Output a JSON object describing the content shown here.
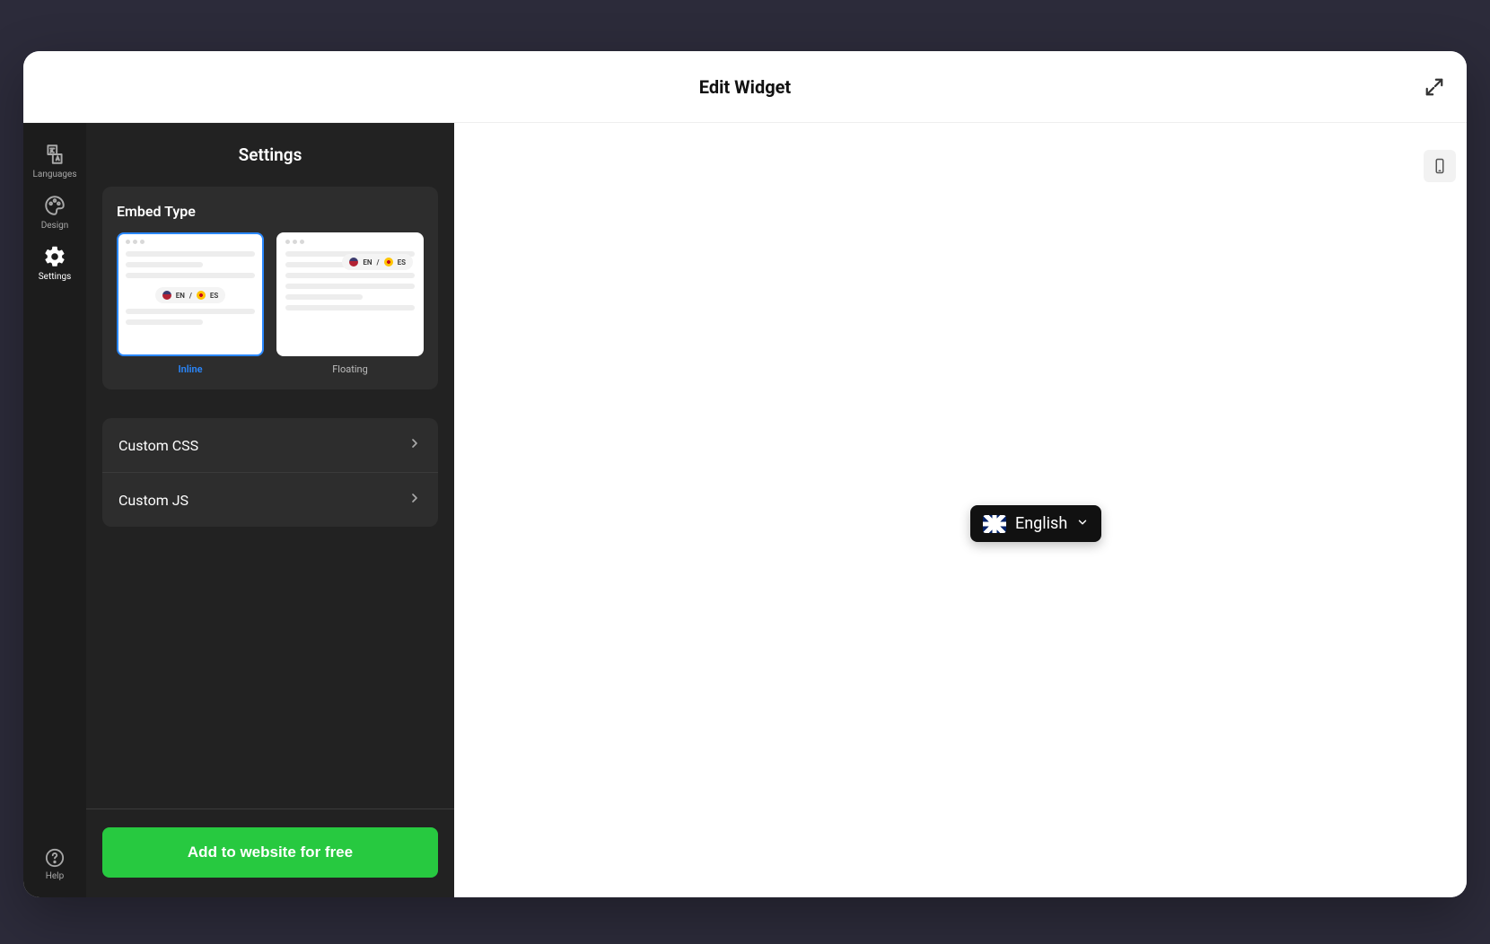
{
  "modal": {
    "title": "Edit Widget"
  },
  "minisidebar": {
    "items": [
      {
        "label": "Languages"
      },
      {
        "label": "Design"
      },
      {
        "label": "Settings"
      }
    ],
    "help": "Help"
  },
  "settings": {
    "heading": "Settings",
    "embed": {
      "title": "Embed Type",
      "options": [
        {
          "label": "Inline",
          "pill_en": "EN",
          "pill_sep": "/",
          "pill_es": "ES"
        },
        {
          "label": "Floating",
          "pill_en": "EN",
          "pill_sep": "/",
          "pill_es": "ES"
        }
      ],
      "selected": 0
    },
    "rows": [
      {
        "label": "Custom CSS"
      },
      {
        "label": "Custom JS"
      }
    ],
    "cta": "Add to website for free"
  },
  "widget": {
    "language": "English"
  }
}
